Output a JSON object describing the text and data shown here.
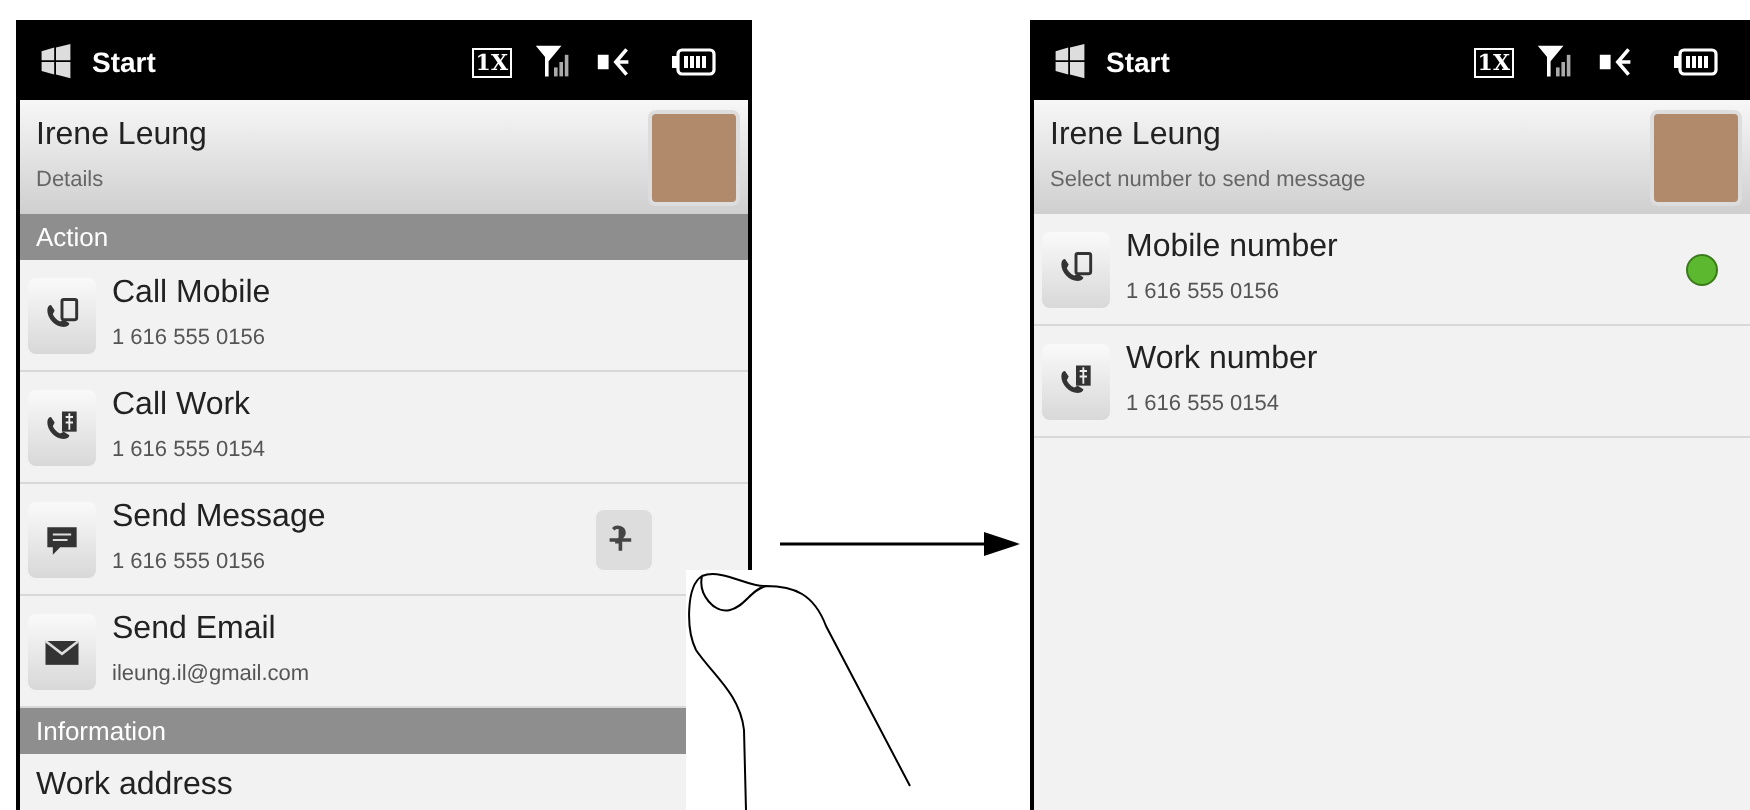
{
  "screens": [
    {
      "status_bar": {
        "title": "Start",
        "network": "1X"
      },
      "contact": {
        "name": "Irene Leung",
        "subtitle": "Details"
      },
      "sections": [
        {
          "kind": "header",
          "label": "Action"
        },
        {
          "kind": "mobile",
          "title": "Call Mobile",
          "detail": "1 616 555 0156",
          "action_button": false,
          "selected": false
        },
        {
          "kind": "work",
          "title": "Call Work",
          "detail": "1 616 555 0154",
          "action_button": false,
          "selected": false
        },
        {
          "kind": "message",
          "title": "Send Message",
          "detail": "1 616 555 0156",
          "action_button": true,
          "selected": false
        },
        {
          "kind": "email",
          "title": "Send Email",
          "detail": "ileung.il@gmail.com",
          "action_button": false,
          "selected": false
        },
        {
          "kind": "header",
          "label": "Information"
        },
        {
          "kind": "plain",
          "title": "Work address"
        }
      ]
    },
    {
      "status_bar": {
        "title": "Start",
        "network": "1X"
      },
      "contact": {
        "name": "Irene Leung",
        "subtitle": "Select number to send message"
      },
      "sections": [
        {
          "kind": "mobile",
          "title": "Mobile number",
          "detail": "1 616 555 0156",
          "action_button": false,
          "selected": true
        },
        {
          "kind": "work",
          "title": "Work number",
          "detail": "1 616 555 0154",
          "action_button": false,
          "selected": false
        }
      ]
    }
  ]
}
